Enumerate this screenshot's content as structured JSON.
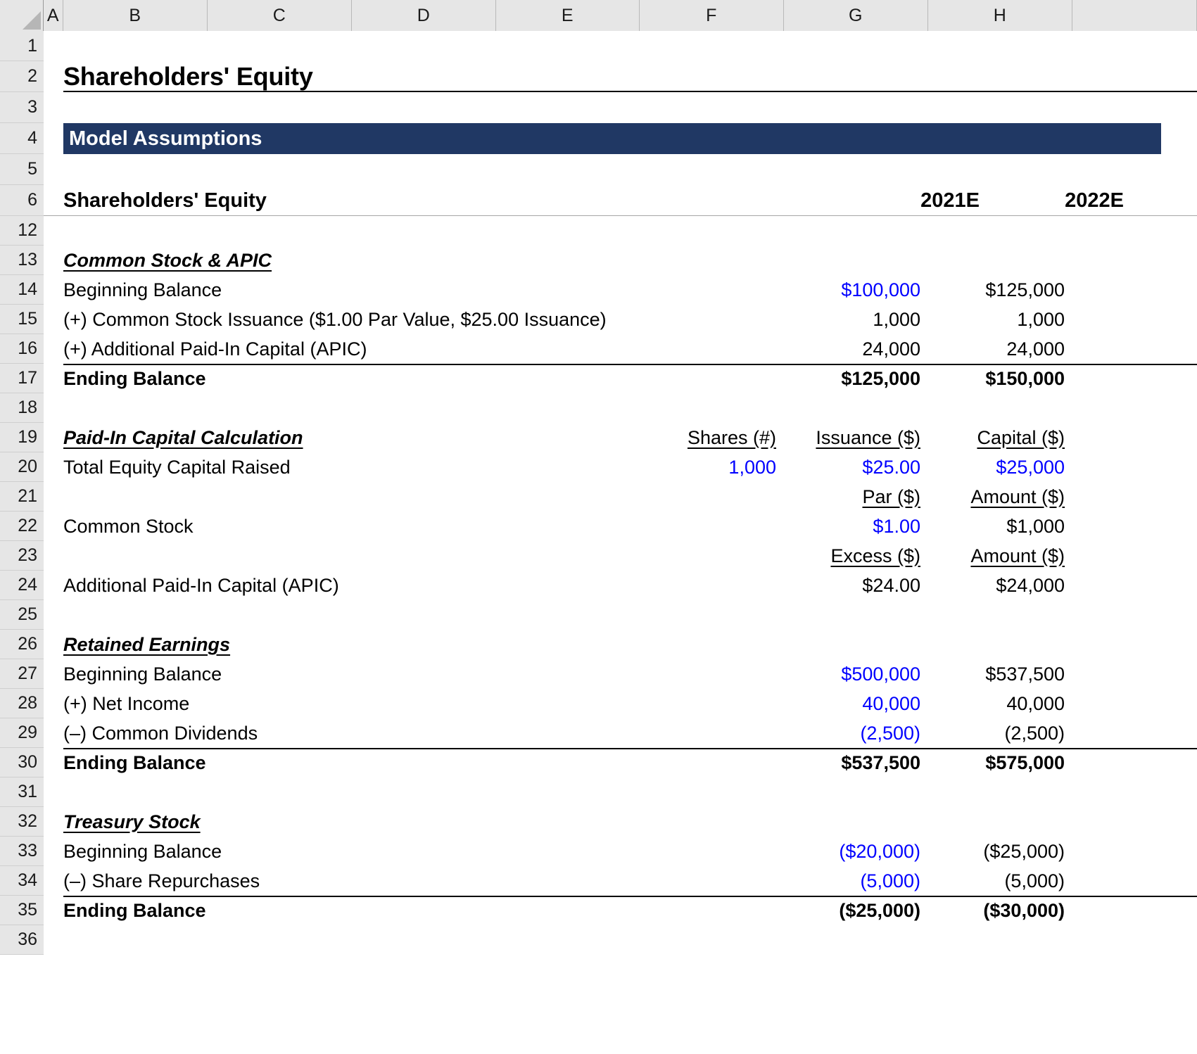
{
  "app": {
    "type": "spreadsheet",
    "corner_name": "select-all-corner"
  },
  "colors": {
    "banner_bg": "#203864",
    "banner_text": "#ffffff",
    "input_blue": "#0000ff",
    "formula_black": "#000000",
    "header_gray": "#e6e6e6",
    "gridline": "#cfcfcf"
  },
  "column_headers": [
    "A",
    "B",
    "C",
    "D",
    "E",
    "F",
    "G",
    "H"
  ],
  "row_headers": [
    "1",
    "2",
    "3",
    "4",
    "5",
    "6",
    "12",
    "13",
    "14",
    "15",
    "16",
    "17",
    "18",
    "19",
    "20",
    "21",
    "22",
    "23",
    "24",
    "25",
    "26",
    "27",
    "28",
    "29",
    "30",
    "31",
    "32",
    "33",
    "34",
    "35",
    "36"
  ],
  "title": "Shareholders' Equity",
  "banner": {
    "label": "Model Assumptions"
  },
  "table_header": {
    "label": "Shareholders' Equity",
    "col_g": "2021E",
    "col_h": "2022E"
  },
  "sections": {
    "common_stock_apic": {
      "heading": "Common Stock & APIC",
      "rows": [
        {
          "label": "Beginning Balance",
          "g": "$100,000",
          "h": "$125,000",
          "g_style": "blue",
          "h_style": "black"
        },
        {
          "label": "(+) Common Stock Issuance ($1.00 Par Value, $25.00 Issuance)",
          "g": "1,000",
          "h": "1,000",
          "g_style": "black",
          "h_style": "black"
        },
        {
          "label": "(+) Additional Paid-In Capital (APIC)",
          "g": "24,000",
          "h": "24,000",
          "g_style": "black",
          "h_style": "black"
        }
      ],
      "total": {
        "label": "Ending Balance",
        "g": "$125,000",
        "h": "$150,000"
      }
    },
    "paid_in_capital": {
      "heading": "Paid-In Capital Calculation",
      "header_row_1": {
        "f": "Shares (#)",
        "g": "Issuance ($)",
        "h": "Capital ($)"
      },
      "row_total_equity": {
        "label": "Total Equity Capital Raised",
        "f": "1,000",
        "g": "$25.00",
        "h": "$25,000",
        "f_style": "blue",
        "g_style": "blue",
        "h_style": "blue"
      },
      "header_row_2": {
        "g": "Par ($)",
        "h": "Amount ($)"
      },
      "row_common_stock": {
        "label": "Common Stock",
        "g": "$1.00",
        "h": "$1,000",
        "g_style": "blue",
        "h_style": "black"
      },
      "header_row_3": {
        "g": "Excess ($)",
        "h": "Amount ($)"
      },
      "row_apic": {
        "label": "Additional Paid-In Capital (APIC)",
        "g": "$24.00",
        "h": "$24,000",
        "g_style": "black",
        "h_style": "black"
      }
    },
    "retained_earnings": {
      "heading": "Retained Earnings",
      "rows": [
        {
          "label": "Beginning Balance",
          "g": "$500,000",
          "h": "$537,500",
          "g_style": "blue",
          "h_style": "black"
        },
        {
          "label": "(+) Net Income",
          "g": "40,000",
          "h": "40,000",
          "g_style": "blue",
          "h_style": "black"
        },
        {
          "label": "(–) Common Dividends",
          "g": "(2,500)",
          "h": "(2,500)",
          "g_style": "blue",
          "h_style": "black"
        }
      ],
      "total": {
        "label": "Ending Balance",
        "g": "$537,500",
        "h": "$575,000"
      }
    },
    "treasury_stock": {
      "heading": "Treasury Stock",
      "rows": [
        {
          "label": "Beginning Balance",
          "g": "($20,000)",
          "h": "($25,000)",
          "g_style": "blue",
          "h_style": "black"
        },
        {
          "label": "(–) Share Repurchases",
          "g": "(5,000)",
          "h": "(5,000)",
          "g_style": "blue",
          "h_style": "black"
        }
      ],
      "total": {
        "label": "Ending Balance",
        "g": "($25,000)",
        "h": "($30,000)"
      }
    }
  }
}
